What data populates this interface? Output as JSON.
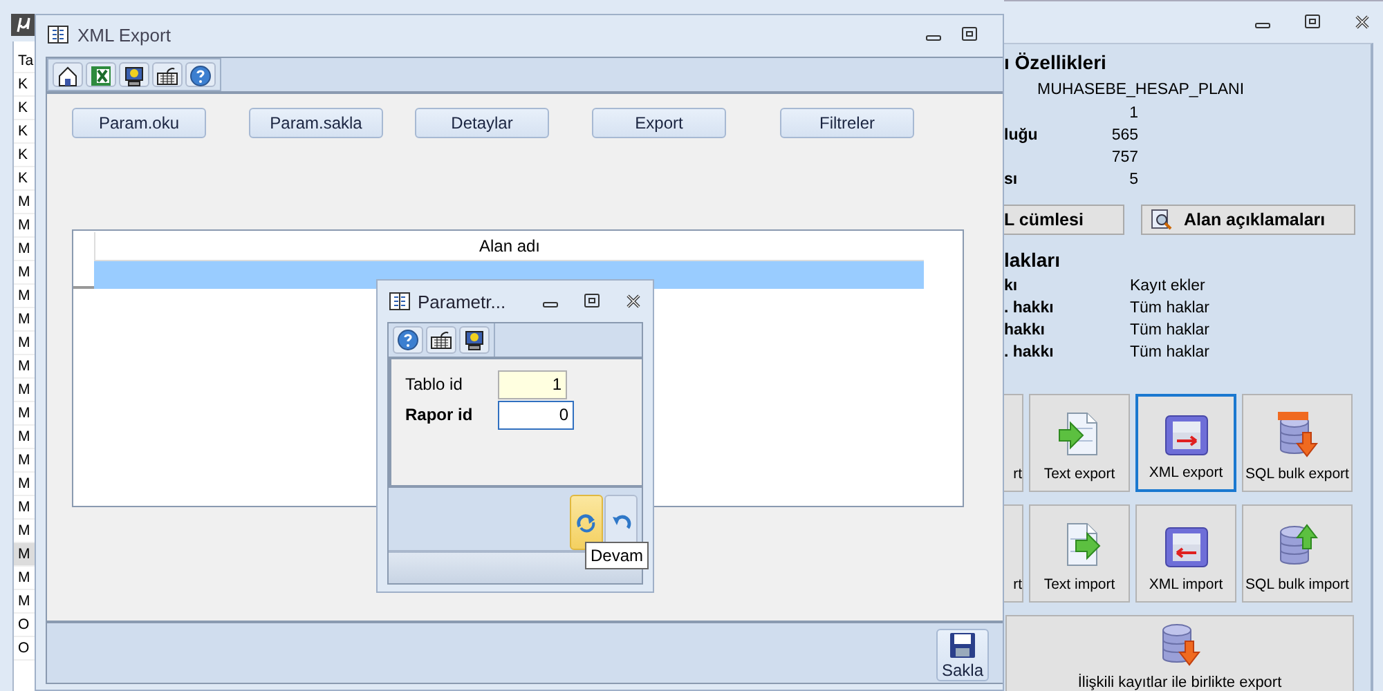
{
  "left_window": {
    "rows": [
      {
        "text": "Ta",
        "selected": false
      },
      {
        "text": "K",
        "selected": false
      },
      {
        "text": "K",
        "selected": false
      },
      {
        "text": "K",
        "selected": false
      },
      {
        "text": "K",
        "selected": false
      },
      {
        "text": "K",
        "selected": false
      },
      {
        "text": "M",
        "selected": false
      },
      {
        "text": "M",
        "selected": false
      },
      {
        "text": "M",
        "selected": false
      },
      {
        "text": "M",
        "selected": false
      },
      {
        "text": "M",
        "selected": false
      },
      {
        "text": "M",
        "selected": false
      },
      {
        "text": "M",
        "selected": false
      },
      {
        "text": "M",
        "selected": false
      },
      {
        "text": "M",
        "selected": false
      },
      {
        "text": "M",
        "selected": false
      },
      {
        "text": "M",
        "selected": false
      },
      {
        "text": "M",
        "selected": false
      },
      {
        "text": "M",
        "selected": false
      },
      {
        "text": "M",
        "selected": false
      },
      {
        "text": "M",
        "selected": false
      },
      {
        "text": "M",
        "selected": true
      },
      {
        "text": "M",
        "selected": false
      },
      {
        "text": "M",
        "selected": false
      },
      {
        "text": "O",
        "selected": false
      },
      {
        "text": "O",
        "selected": false
      }
    ]
  },
  "right_window": {
    "section_title": "ı Özellikleri",
    "table_name": "MUHASEBE_HESAP_PLANI",
    "properties": [
      {
        "value": "1"
      },
      {
        "label": "luğu",
        "value": "565"
      },
      {
        "value": "757"
      },
      {
        "label": "sı",
        "value": "5"
      }
    ],
    "buttons": [
      {
        "label": "L cümlesi",
        "kind": "plain"
      },
      {
        "label": "Alan açıklamaları",
        "kind": "search"
      }
    ],
    "rights_title": "lakları",
    "rights": [
      {
        "label": "kı",
        "value": "Kayıt ekler"
      },
      {
        "label": ". hakkı",
        "value": "Tüm haklar"
      },
      {
        "label": "hakkı",
        "value": "Tüm haklar"
      },
      {
        "label": ". hakkı",
        "value": "Tüm haklar"
      }
    ],
    "tiles": [
      {
        "label": "rt",
        "kind": "cut",
        "selected": false
      },
      {
        "label": "Text export",
        "kind": "text-export",
        "selected": false
      },
      {
        "label": "XML export",
        "kind": "xml-export",
        "selected": true
      },
      {
        "label": "SQL bulk export",
        "kind": "sql-export",
        "selected": false
      },
      {
        "label": "rt",
        "kind": "cut",
        "selected": false
      },
      {
        "label": "Text import",
        "kind": "text-import",
        "selected": false
      },
      {
        "label": "XML import",
        "kind": "xml-import",
        "selected": false
      },
      {
        "label": "SQL bulk import",
        "kind": "sql-import",
        "selected": false
      }
    ],
    "wide_tile": {
      "label": "İlişkili kayıtlar ile birlikte export"
    }
  },
  "export_window": {
    "title": "XML Export",
    "buttons": [
      "Param.oku",
      "Param.sakla",
      "Detaylar",
      "Export",
      "Filtreler"
    ],
    "grid": {
      "columns": [
        "Alan adı"
      ],
      "rows": [
        {
          "selected": true
        }
      ]
    },
    "save_button": "Sakla"
  },
  "dialog": {
    "title": "Parametr...",
    "fields": [
      {
        "label": "Tablo id",
        "value": "1",
        "required": false,
        "readonly": true,
        "focused": false
      },
      {
        "label": "Rapor id",
        "value": "0",
        "required": true,
        "readonly": false,
        "focused": true
      }
    ],
    "buttons": [
      {
        "kind": "continue",
        "highlighted": true
      },
      {
        "kind": "cancel",
        "highlighted": false
      }
    ],
    "tooltip": "Devam"
  }
}
